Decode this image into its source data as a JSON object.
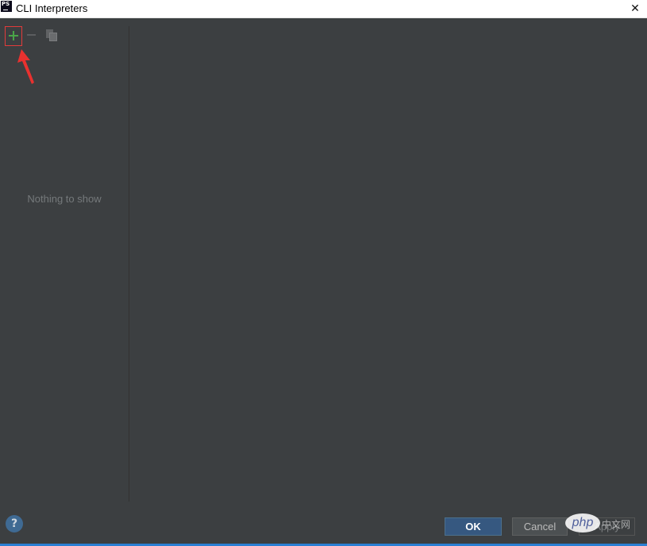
{
  "window": {
    "title": "CLI Interpreters",
    "app_icon_text": "PS",
    "close_glyph": "✕"
  },
  "toolbar": {
    "add_icon": "plus-icon",
    "remove_icon": "minus-icon",
    "copy_icon": "copy-icon"
  },
  "list": {
    "empty_text": "Nothing to show"
  },
  "footer": {
    "help_glyph": "?",
    "ok_label": "OK",
    "cancel_label": "Cancel",
    "apply_label": "Apply"
  },
  "watermark": {
    "logo_text": "php",
    "site_text": "中文网"
  },
  "colors": {
    "background": "#3c3f41",
    "add_icon": "#4aa548",
    "highlight_box": "#e33b3b",
    "annotation_arrow": "#e8312f",
    "ok_button": "#365880"
  }
}
